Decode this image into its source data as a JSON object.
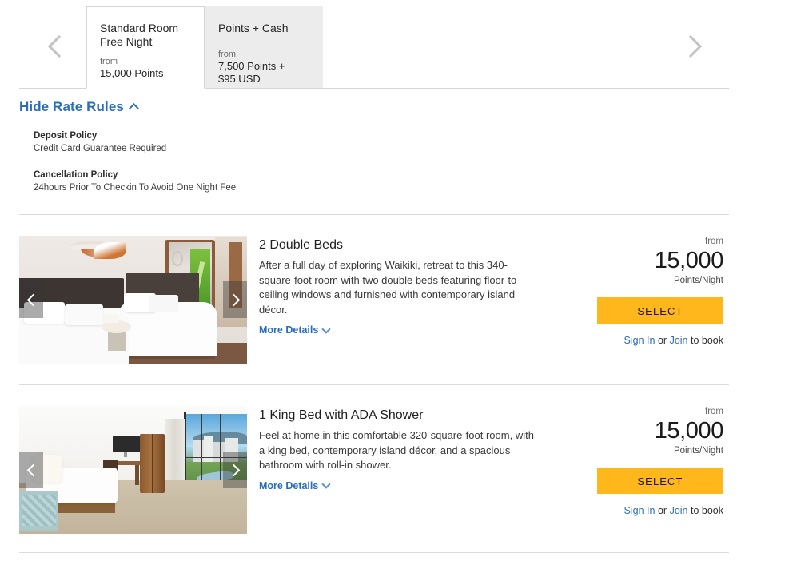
{
  "rate_tabs": {
    "prev_label": "previous-rate",
    "next_label": "next-rate",
    "items": [
      {
        "title_line1": "Standard Room",
        "title_line2": "Free Night",
        "from_label": "from",
        "price": "15,000 Points",
        "active": true
      },
      {
        "title_line1": "Points + Cash",
        "title_line2": "",
        "from_label": "from",
        "price_line1": "7,500 Points +",
        "price_line2": "$95 USD",
        "active": false
      }
    ]
  },
  "rate_rules": {
    "toggle_label": "Hide Rate Rules",
    "policies": [
      {
        "title": "Deposit Policy",
        "text": "Credit Card Guarantee Required"
      },
      {
        "title": "Cancellation Policy",
        "text": "24hours Prior To Checkin To Avoid One Night Fee"
      }
    ]
  },
  "rooms": [
    {
      "title": "2 Double Beds",
      "description": "After a full day of exploring Waikiki, retreat to this 340-square-foot room with two double beds featuring floor-to-ceiling windows and furnished with contemporary island décor.",
      "more_details_label": "More Details",
      "from_label": "from",
      "amount": "15,000",
      "unit": "Points/Night",
      "select_label": "SELECT",
      "sign_in_label": "Sign In",
      "or_label": "or",
      "join_label": "Join",
      "to_book_label": "to book",
      "photo_alt": "hotel-room-two-double-beds"
    },
    {
      "title": "1 King Bed with ADA Shower",
      "description": "Feel at home in this comfortable 320-square-foot room, with a king bed, contemporary island décor, and a spacious bathroom with roll-in shower.",
      "more_details_label": "More Details",
      "from_label": "from",
      "amount": "15,000",
      "unit": "Points/Night",
      "select_label": "SELECT",
      "sign_in_label": "Sign In",
      "or_label": "or",
      "join_label": "Join",
      "to_book_label": "to book",
      "photo_alt": "hotel-room-king-bed-city-view"
    }
  ],
  "colors": {
    "accent_button": "#FFB71B",
    "link": "#2a6ebb",
    "tab_inactive_bg": "#ececec",
    "divider": "#dcdcdc"
  }
}
